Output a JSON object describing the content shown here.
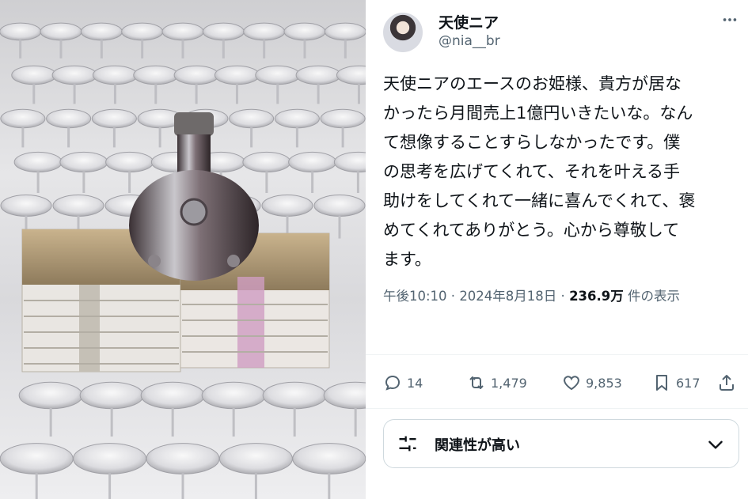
{
  "user": {
    "display_name": "天使ニア",
    "handle": "@nia__br"
  },
  "tweet": {
    "text": "天使ニアのエースのお姫様、貴方が居な\nかったら月間売上1億円いきたいな。なん\nて想像することすらしなかったです。僕\nの思考を広げてくれて、それを叶える手\n助けをしてくれて一緒に喜んでくれて、褒\nめてくれてありがとう。心から尊敬して\nます。",
    "time": "午後10:10",
    "separator": " · ",
    "date": "2024年8月18日",
    "views": "236.9万",
    "views_suffix": " 件の表示"
  },
  "actions": {
    "replies": "14",
    "reposts": "1,479",
    "likes": "9,853",
    "bookmarks": "617"
  },
  "sort": {
    "label": "関連性が高い"
  },
  "icons": {
    "more": "more-icon",
    "reply": "reply-icon",
    "repost": "repost-icon",
    "like": "heart-icon",
    "bookmark": "bookmark-icon",
    "share": "share-icon",
    "filter": "filter-icon",
    "chevron": "chevron-down-icon"
  }
}
